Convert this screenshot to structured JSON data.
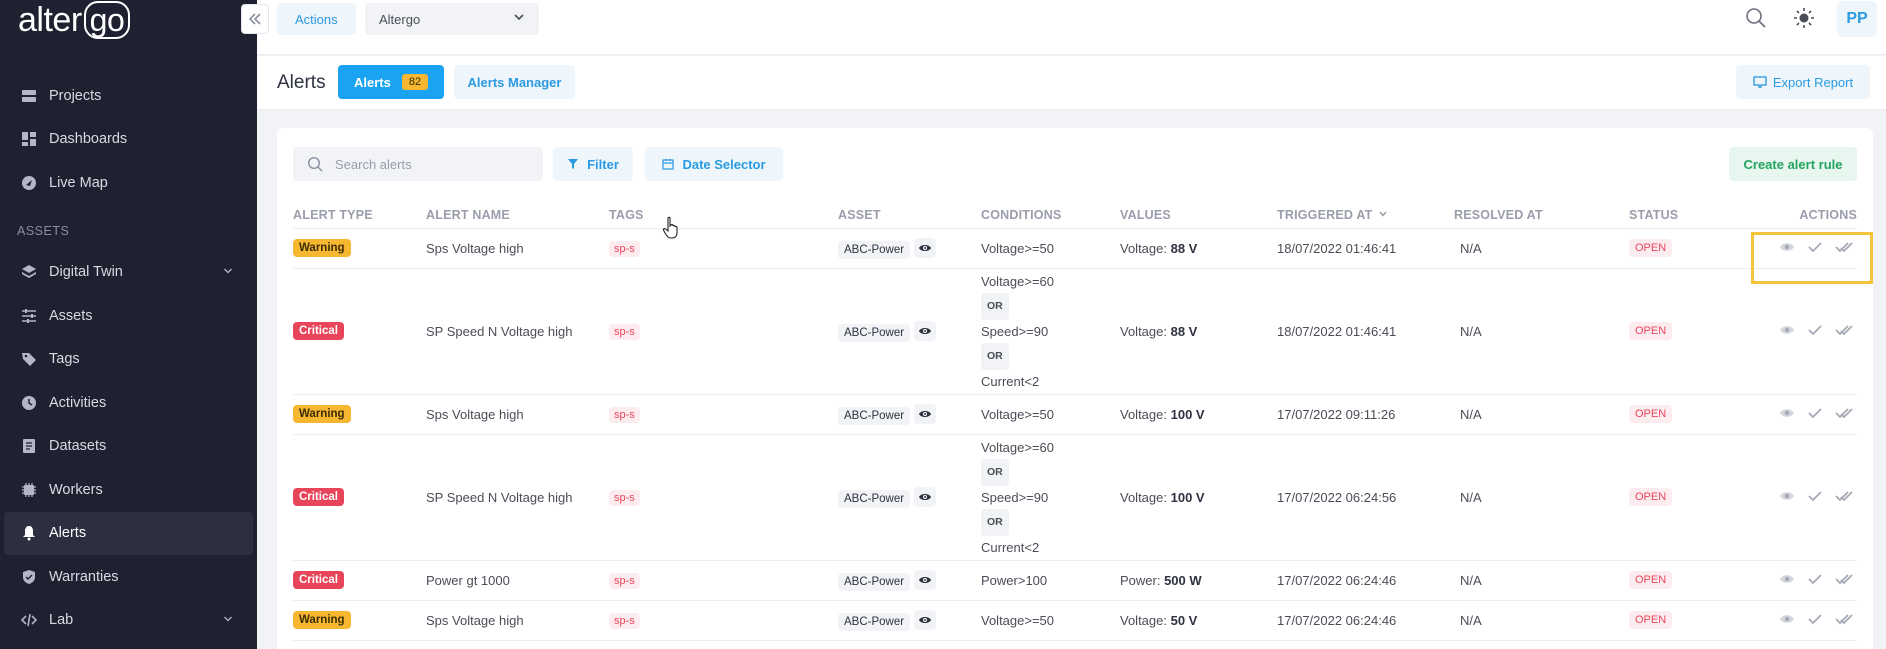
{
  "sidebar": {
    "logo": {
      "main": "alter",
      "boxed": "go"
    },
    "items": [
      {
        "label": "Projects",
        "icon": "projects-icon"
      },
      {
        "label": "Dashboards",
        "icon": "dashboards-icon"
      },
      {
        "label": "Live Map",
        "icon": "live-map-icon"
      }
    ],
    "section_label": "ASSETS",
    "asset_items": [
      {
        "label": "Digital Twin",
        "icon": "digital-twin-icon",
        "expandable": true
      },
      {
        "label": "Assets",
        "icon": "assets-icon"
      },
      {
        "label": "Tags",
        "icon": "tags-icon"
      },
      {
        "label": "Activities",
        "icon": "activities-icon"
      },
      {
        "label": "Datasets",
        "icon": "datasets-icon"
      },
      {
        "label": "Workers",
        "icon": "workers-icon"
      },
      {
        "label": "Alerts",
        "icon": "bell-icon",
        "active": true
      },
      {
        "label": "Warranties",
        "icon": "shield-icon"
      },
      {
        "label": "Lab",
        "icon": "code-icon",
        "expandable": true
      }
    ]
  },
  "topbar": {
    "actions_label": "Actions",
    "project_select": "Altergo",
    "avatar_initials": "PP"
  },
  "header": {
    "title": "Alerts",
    "tabs": [
      {
        "label": "Alerts",
        "count": "82",
        "active": true
      },
      {
        "label": "Alerts Manager"
      }
    ],
    "export_label": "Export Report"
  },
  "toolbar": {
    "search_placeholder": "Search alerts",
    "filter_label": "Filter",
    "date_label": "Date Selector",
    "create_label": "Create alert rule"
  },
  "table": {
    "columns": [
      "ALERT TYPE",
      "ALERT NAME",
      "TAGS",
      "ASSET",
      "CONDITIONS",
      "VALUES",
      "TRIGGERED AT",
      "RESOLVED AT",
      "STATUS",
      "ACTIONS"
    ],
    "rows": [
      {
        "type": "Warning",
        "name": "Sps Voltage high",
        "tag": "sp-s",
        "asset": "ABC-Power",
        "conditions": [
          "Voltage>=50"
        ],
        "value_label": "Voltage:",
        "value": "88 V",
        "triggered": "18/07/2022 01:46:41",
        "resolved": "N/A",
        "status": "OPEN"
      },
      {
        "type": "Critical",
        "name": "SP Speed N Voltage high",
        "tag": "sp-s",
        "asset": "ABC-Power",
        "conditions": [
          "Voltage>=60",
          "OR",
          "Speed>=90",
          "OR",
          "Current<2"
        ],
        "value_label": "Voltage:",
        "value": "88 V",
        "triggered": "18/07/2022 01:46:41",
        "resolved": "N/A",
        "status": "OPEN"
      },
      {
        "type": "Warning",
        "name": "Sps Voltage high",
        "tag": "sp-s",
        "asset": "ABC-Power",
        "conditions": [
          "Voltage>=50"
        ],
        "value_label": "Voltage:",
        "value": "100 V",
        "triggered": "17/07/2022 09:11:26",
        "resolved": "N/A",
        "status": "OPEN"
      },
      {
        "type": "Critical",
        "name": "SP Speed N Voltage high",
        "tag": "sp-s",
        "asset": "ABC-Power",
        "conditions": [
          "Voltage>=60",
          "OR",
          "Speed>=90",
          "OR",
          "Current<2"
        ],
        "value_label": "Voltage:",
        "value": "100 V",
        "triggered": "17/07/2022 06:24:56",
        "resolved": "N/A",
        "status": "OPEN"
      },
      {
        "type": "Critical",
        "name": "Power gt 1000",
        "tag": "sp-s",
        "asset": "ABC-Power",
        "conditions": [
          "Power>100"
        ],
        "value_label": "Power:",
        "value": "500 W",
        "triggered": "17/07/2022 06:24:46",
        "resolved": "N/A",
        "status": "OPEN"
      },
      {
        "type": "Warning",
        "name": "Sps Voltage high",
        "tag": "sp-s",
        "asset": "ABC-Power",
        "conditions": [
          "Voltage>=50"
        ],
        "value_label": "Voltage:",
        "value": "50 V",
        "triggered": "17/07/2022 06:24:46",
        "resolved": "N/A",
        "status": "OPEN"
      }
    ]
  },
  "colors": {
    "accent": "#1aa3f0",
    "warning": "#f7b731",
    "critical": "#e8455a",
    "sidebar": "#1f2130",
    "highlight": "#f2c53d"
  }
}
